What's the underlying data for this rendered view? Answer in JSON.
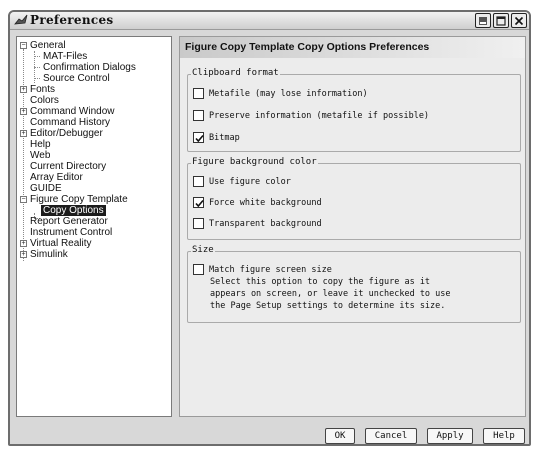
{
  "window": {
    "title": "Preferences",
    "controls": [
      "minimize-icon",
      "maximize-icon",
      "close-icon"
    ]
  },
  "tree": {
    "general": "General",
    "mat_files": "MAT-Files",
    "confirmation_dialogs": "Confirmation Dialogs",
    "source_control": "Source Control",
    "fonts": "Fonts",
    "colors": "Colors",
    "command_window": "Command Window",
    "command_history": "Command History",
    "editor_debugger": "Editor/Debugger",
    "help": "Help",
    "web": "Web",
    "current_directory": "Current Directory",
    "array_editor": "Array Editor",
    "guide": "GUIDE",
    "figure_copy_template": "Figure Copy Template",
    "copy_options": "Copy Options",
    "report_generator": "Report Generator",
    "instrument_control": "Instrument Control",
    "virtual_reality": "Virtual Reality",
    "simulink": "Simulink"
  },
  "panel": {
    "title": "Figure Copy Template Copy Options Preferences",
    "clipboard": {
      "title": "Clipboard format",
      "metafile": "Metafile (may lose information)",
      "metafile_checked": false,
      "preserve": "Preserve information (metafile if possible)",
      "preserve_checked": false,
      "bitmap": "Bitmap",
      "bitmap_checked": true
    },
    "background": {
      "title": "Figure background color",
      "use_figure": "Use figure color",
      "use_figure_checked": false,
      "force_white": "Force white background",
      "force_white_checked": true,
      "transparent": "Transparent background",
      "transparent_checked": false
    },
    "size": {
      "title": "Size",
      "match": "Match figure screen size",
      "match_checked": false,
      "desc_line1": "Select this option to copy the figure as it",
      "desc_line2": "appears on screen, or leave it unchecked to use",
      "desc_line3": "the Page Setup settings to determine its size."
    }
  },
  "buttons": {
    "ok": "OK",
    "cancel": "Cancel",
    "apply": "Apply",
    "help": "Help"
  }
}
